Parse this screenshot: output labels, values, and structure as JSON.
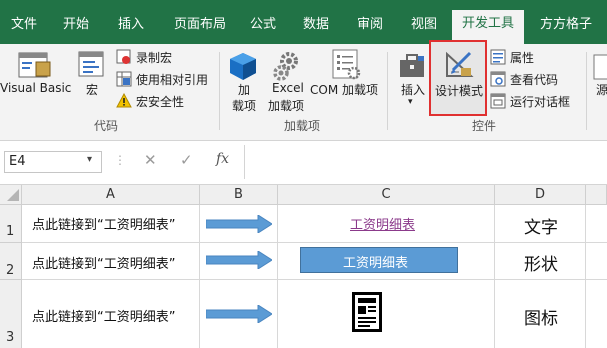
{
  "ribbon_tabs": [
    "文件",
    "开始",
    "插入",
    "页面布局",
    "公式",
    "数据",
    "审阅",
    "视图",
    "开发工具",
    "方方格子"
  ],
  "active_tab": "开发工具",
  "code_group": {
    "label": "代码",
    "visual_basic": "Visual Basic",
    "macros": "宏",
    "record_macro": "录制宏",
    "relative_refs": "使用相对引用",
    "macro_security": "宏安全性"
  },
  "addins_group": {
    "label": "加载项",
    "addins_line1": "加",
    "addins_line2": "载项",
    "excel_addins_line1": "Excel",
    "excel_addins_line2": "加载项",
    "com_addins": "COM 加载项"
  },
  "controls_group": {
    "label": "控件",
    "insert": "插入",
    "design_mode": "设计模式",
    "properties": "属性",
    "view_code": "查看代码",
    "run_dialog": "运行对话框"
  },
  "source_partial": "源",
  "formula_bar": {
    "name_box": "E4",
    "cancel": "✕",
    "enter": "✓",
    "fx": "fx",
    "formula": ""
  },
  "columns": [
    "A",
    "B",
    "C",
    "D"
  ],
  "rows": [
    "1",
    "2",
    "3"
  ],
  "sheet": {
    "link_text": "点此链接到“工资明细表”",
    "c1_hyperlink": "工资明细表",
    "c2_button": "工资明细表",
    "d1": "文字",
    "d2": "形状",
    "d3": "图标"
  },
  "colors": {
    "ribbon_green": "#217346",
    "arrow_blue": "#5b9bd5",
    "hyperlink": "#8b3a8b",
    "highlight_red": "#e03030"
  }
}
